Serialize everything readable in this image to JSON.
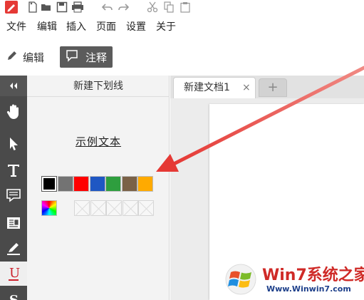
{
  "quick_access": {
    "icons": [
      "app-logo",
      "new-file-icon",
      "open-folder-icon",
      "save-icon",
      "print-icon",
      "undo-icon",
      "redo-icon",
      "cut-icon",
      "copy-icon",
      "paste-icon"
    ]
  },
  "menu": {
    "items": [
      "文件",
      "编辑",
      "插入",
      "页面",
      "设置",
      "关于"
    ]
  },
  "modes": {
    "edit_label": "编辑",
    "annotate_label": "注释",
    "active": "annotate"
  },
  "tools": [
    "collapse-icon",
    "hand-icon",
    "pointer-icon",
    "text-icon",
    "comment-icon",
    "note-icon",
    "highlighter-icon",
    "underline-icon",
    "strikethrough-icon"
  ],
  "panel": {
    "title": "新建下划线",
    "sample_text": "示例文本",
    "colors": [
      "#000000",
      "#737373",
      "#ff0000",
      "#1f57c3",
      "#2e9e3e",
      "#7a6147",
      "#ffaa00"
    ],
    "selected_color": "#000000",
    "custom_slots": 5
  },
  "tabs": {
    "document_title": "新建文档1",
    "close": "×",
    "new_tab": "+"
  },
  "watermark": {
    "line1": "Win7系统之家",
    "line2": "Www.Winwin7.com"
  },
  "annotation_color": "#e53935"
}
